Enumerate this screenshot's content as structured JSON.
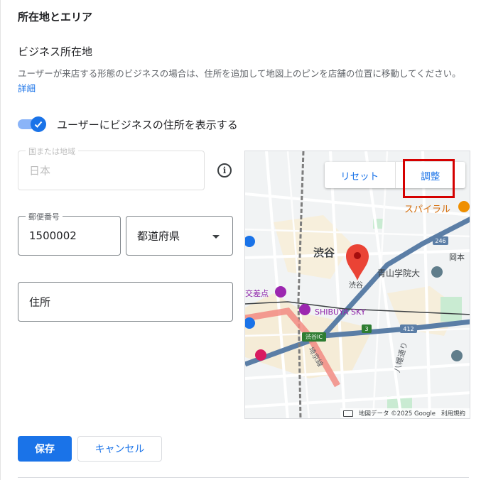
{
  "section": {
    "title": "所在地とエリア",
    "subtitle": "ビジネス所在地",
    "description": "ユーザーが来店する形態のビジネスの場合は、住所を追加して地図上のピンを店舗の位置に移動してください。",
    "details_link": "詳細"
  },
  "toggle": {
    "label": "ユーザーにビジネスの住所を表示する",
    "checked": true
  },
  "fields": {
    "country": {
      "label": "国または地域",
      "value": "日本"
    },
    "postal": {
      "label": "郵便番号",
      "value": "1500002"
    },
    "prefecture": {
      "value": "都道府県"
    },
    "address": {
      "value": "住所"
    }
  },
  "map": {
    "reset_label": "リセット",
    "adjust_label": "調整",
    "labels": {
      "spiral": "スパイラル",
      "shibuya": "渋谷",
      "shibuya_small": "渋谷",
      "aoyama": "青山学院大",
      "shibuya_sky": "SHIBUYA SKY",
      "crossing": "交差点",
      "shibuya_ic": "渋谷IC",
      "okamoto": "岡本",
      "meiji": "八幡通り",
      "kyo": "埼京線",
      "route246": "246",
      "route412": "412",
      "route3": "3"
    },
    "attribution": "地図データ ©2025 Google",
    "terms": "利用規約",
    "colors": {
      "pin": "#ea4335",
      "highway": "#5b7ea6",
      "highlight": "#d50000"
    }
  },
  "buttons": {
    "save": "保存",
    "cancel": "キャンセル"
  },
  "colors": {
    "accent": "#1a73e8"
  }
}
